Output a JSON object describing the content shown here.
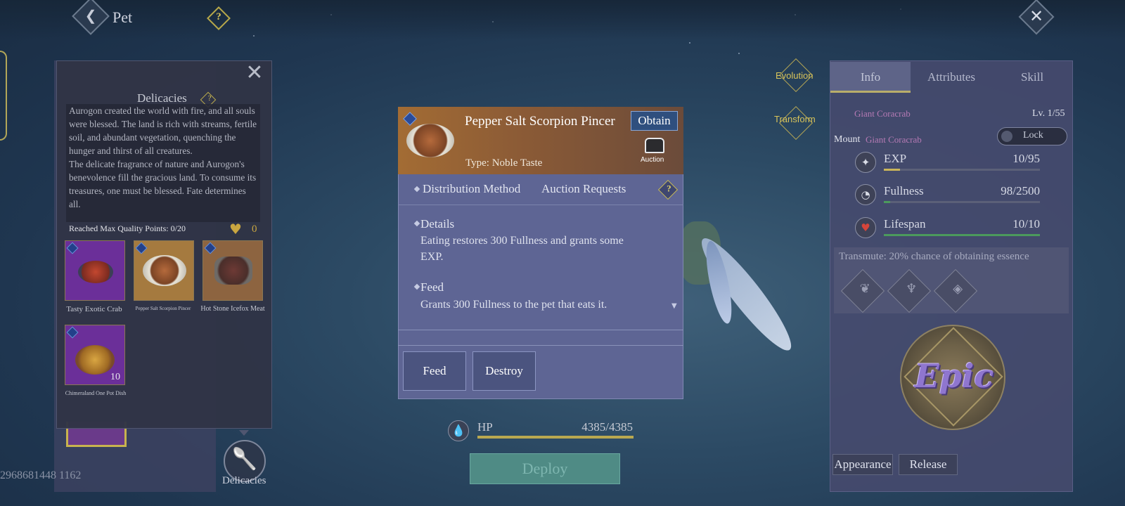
{
  "header": {
    "title": "Pet",
    "help_glyph": "?",
    "back_glyph": "❮",
    "close_glyph": "✕"
  },
  "player_id": "2968681448 1162",
  "delicacies_panel": {
    "title": "Delicacies",
    "close_glyph": "✕",
    "lore": [
      "Aurogon created the world with fire, and all souls were blessed. The land is rich with streams, fertile soil, and abundant vegetation, quenching the hunger and thirst of all creatures.",
      "The delicate fragrance of nature and Aurogon's benevolence fill the gracious land. To consume its treasures, one must be blessed. Fate determines all."
    ],
    "quality_points": "Reached Max Quality Points: 0/20",
    "heart_count": "0",
    "items": [
      {
        "name": "Tasty Exotic Crab",
        "qty": ""
      },
      {
        "name": "Pepper Salt Scorpion Pincer",
        "qty": ""
      },
      {
        "name": "Hot Stone Icefox Meat",
        "qty": ""
      },
      {
        "name": "Chimeraland One Pot Dish",
        "qty": "10"
      }
    ]
  },
  "shortcut": {
    "label": "Delicacies"
  },
  "scene": {
    "evolution_label": "Evolution",
    "transform_label": "Transform",
    "hp_label": "HP",
    "hp_value": "4385/4385",
    "hp_fraction": 1.0,
    "deploy_label": "Deploy"
  },
  "tooltip": {
    "item_name": "Pepper Salt Scorpion Pincer",
    "obtain_label": "Obtain",
    "type": "Type: Noble Taste",
    "auction_label": "Auction",
    "distribution_label": "Distribution Method",
    "distribution_value": "Auction Requests",
    "details_title": "Details",
    "details_text": "Eating restores 300 Fullness and grants some EXP.",
    "feed_title": "Feed",
    "feed_text": "Grants 300 Fullness to the pet that eats it.",
    "feed_button": "Feed",
    "destroy_button": "Destroy"
  },
  "info_panel": {
    "tabs": [
      "Info",
      "Attributes",
      "Skill"
    ],
    "active_tab": "Info",
    "pet_name": "Giant Coracrab",
    "level": "Lv. 1/55",
    "mount_label": "Mount",
    "mount_name": "Giant Coracrab",
    "lock_label": "Lock",
    "stats": [
      {
        "label": "EXP",
        "value": "10/95",
        "fraction": 0.105,
        "color": "#c9b55a"
      },
      {
        "label": "Fullness",
        "value": "98/2500",
        "fraction": 0.039,
        "color": "#4c9a5c"
      },
      {
        "label": "Lifespan",
        "value": "10/10",
        "fraction": 1.0,
        "color": "#4c9a5c"
      }
    ],
    "transmute_text": "Transmute: 20% chance of obtaining essence",
    "rarity": "Epic",
    "appearance_button": "Appearance",
    "release_button": "Release"
  }
}
